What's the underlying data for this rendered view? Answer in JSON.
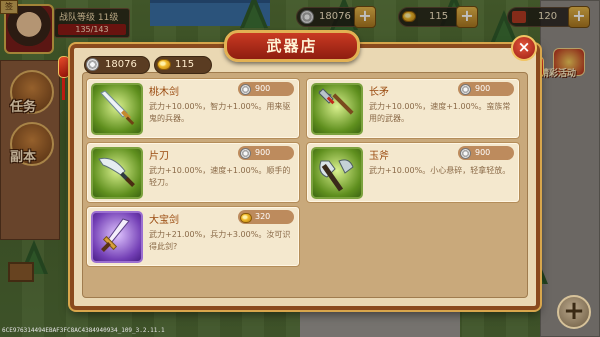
{
  "hud": {
    "player_level_label": "战队等级 11级",
    "hp_text": "135/143",
    "silver_amount": "18076",
    "gold_amount": "115",
    "misc_amount": "120",
    "plus_label": "+"
  },
  "side": {
    "quest_label": "任务",
    "dungeon_label": "副本",
    "corner_label": "签",
    "event_label": "精彩活动"
  },
  "shop": {
    "title": "武器店",
    "close_label": "×",
    "silver": "18076",
    "gold": "115",
    "items": [
      {
        "name": "桃木剑",
        "currency": "silver",
        "price": "900",
        "desc": "武力+10.00%，智力+1.00%。用来驱鬼的兵器。",
        "icon": "wooden-sword-icon"
      },
      {
        "name": "长矛",
        "currency": "silver",
        "price": "900",
        "desc": "武力+10.00%，速度+1.00%。蛮族常用的武器。",
        "icon": "spear-icon"
      },
      {
        "name": "片刀",
        "currency": "silver",
        "price": "900",
        "desc": "武力+10.00%，速度+1.00%。顺手的轻刀。",
        "icon": "broadsword-icon"
      },
      {
        "name": "玉斧",
        "currency": "silver",
        "price": "900",
        "desc": "武力+10.00%。小心悬碎，轻拿轻放。",
        "icon": "jade-axe-icon"
      },
      {
        "name": "大宝剑",
        "currency": "gold",
        "price": "320",
        "desc": "武力+21.00%，兵力+3.00%。汝可识得此剑?",
        "icon": "great-sword-icon"
      }
    ]
  },
  "footer": {
    "build_id": "6CE976314494EBAF3FC8AC4384940934_109_3.2.11.1",
    "add_label": "+"
  },
  "colors": {
    "panel_border": "#8a4a1e",
    "title_red": "#c93a22",
    "item_name": "#9a4a0f",
    "item_desc": "#8a6a48"
  }
}
